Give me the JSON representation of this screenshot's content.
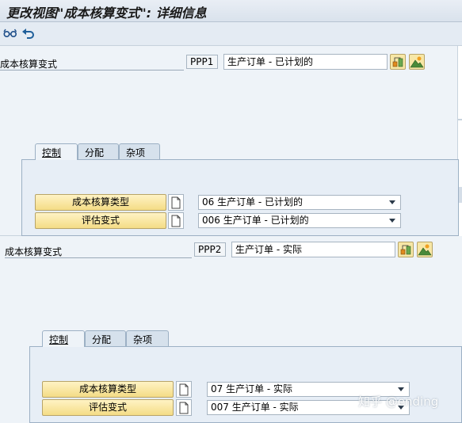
{
  "title": "更改视图\"成本核算变式\": 详细信息",
  "toolbar": {
    "icons": [
      "glasses-icon",
      "undo-icon"
    ]
  },
  "panel1": {
    "field_label": "成本核算变式",
    "code": "PPP1",
    "description": "生产订单 - 已计划的",
    "tabs": [
      "控制",
      "分配",
      "杂项"
    ],
    "rows": [
      {
        "button": "成本核算类型",
        "value": "06 生产订单 - 已计划的"
      },
      {
        "button": "评估变式",
        "value": "006 生产订单 - 已计划的"
      }
    ]
  },
  "panel2": {
    "field_label": "成本核算变式",
    "code": "PPP2",
    "description": "生产订单 - 实际",
    "tabs": [
      "控制",
      "分配",
      "杂项"
    ],
    "rows": [
      {
        "button": "成本核算类型",
        "value": "07 生产订单 - 实际"
      },
      {
        "button": "评估变式",
        "value": "007 生产订单 - 实际"
      }
    ]
  },
  "watermark": "知乎 @ending",
  "colors": {
    "button_yellow": "#f4dc86",
    "panel_bg": "#eef3f8",
    "tab_bg": "#d6e1ec"
  }
}
